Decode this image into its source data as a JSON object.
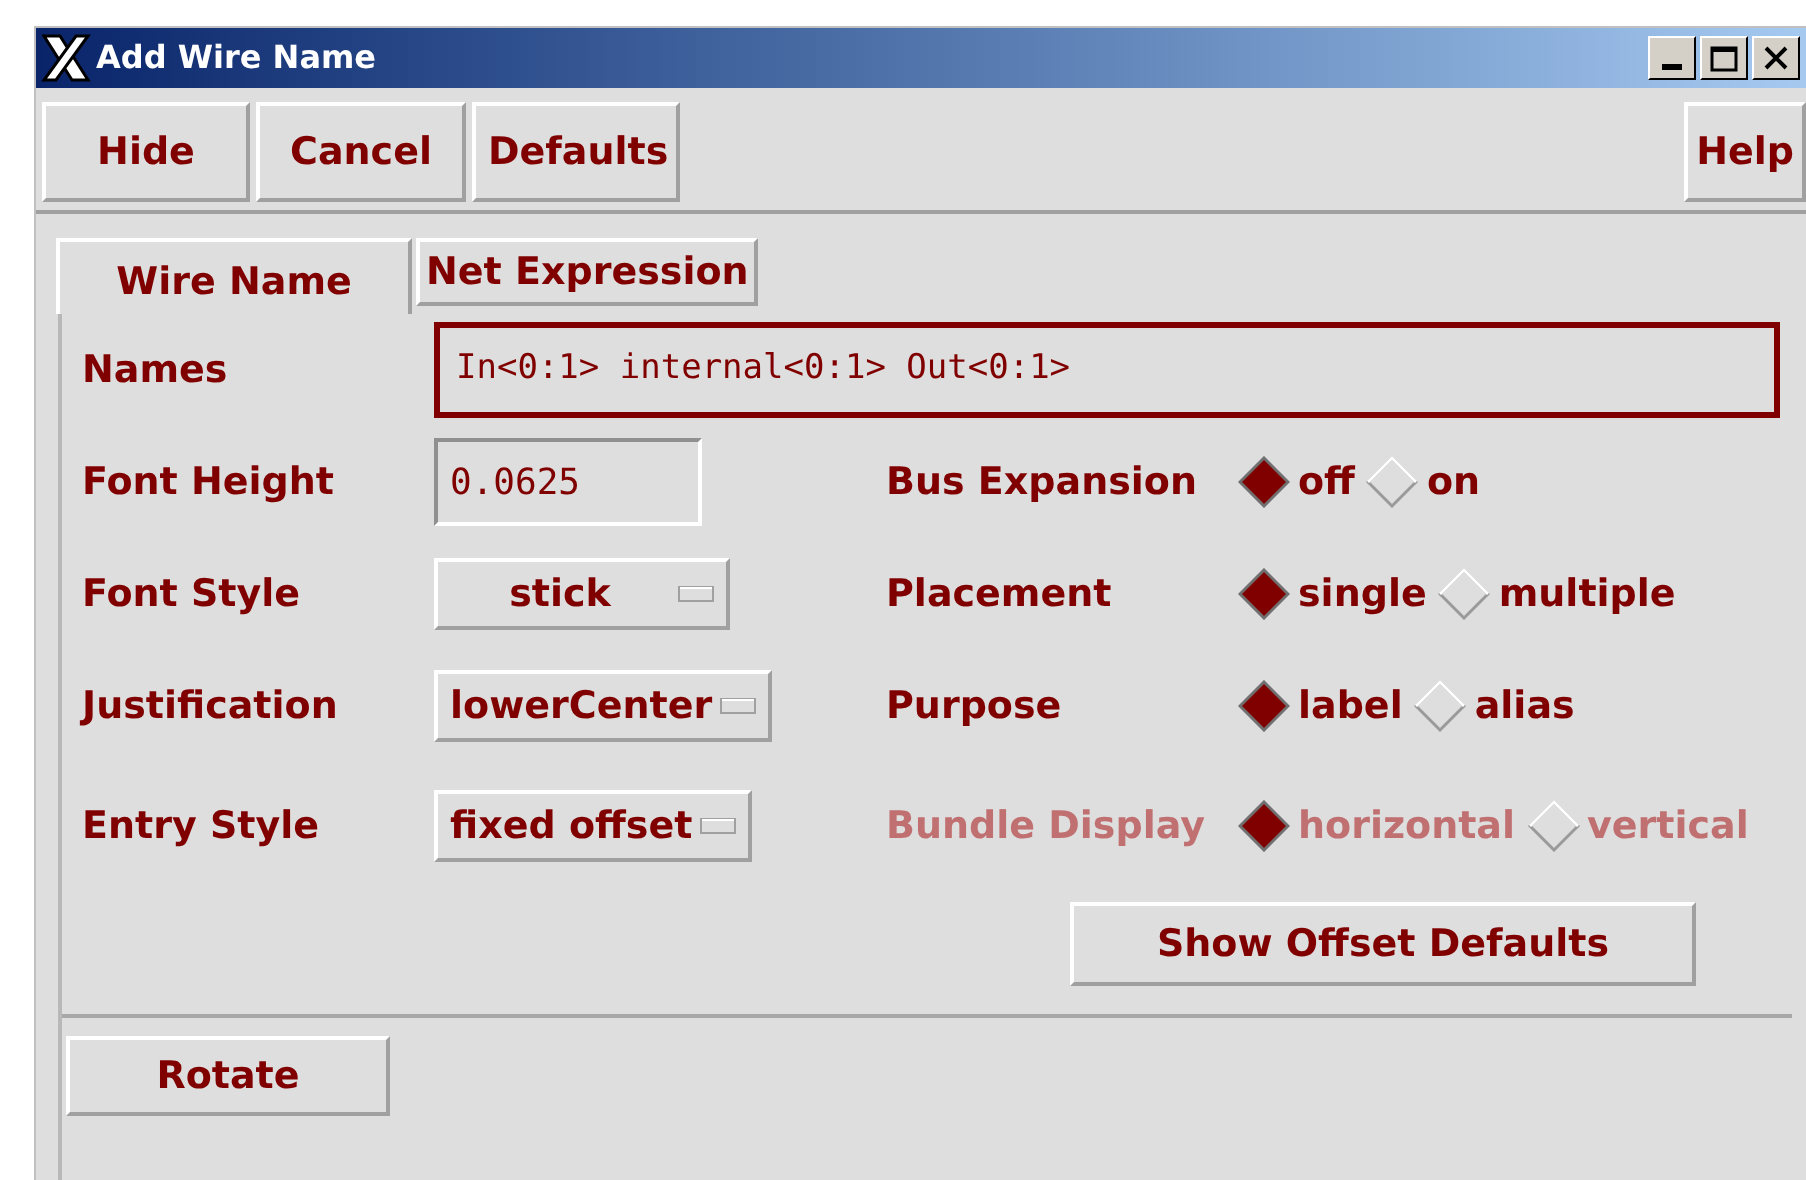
{
  "window": {
    "title": "Add Wire Name"
  },
  "toolbar": [
    {
      "label": "Hide"
    },
    {
      "label": "Cancel"
    },
    {
      "label": "Defaults"
    }
  ],
  "help_button": "Help",
  "tabs": [
    {
      "label": "Wire Name",
      "selected": true
    },
    {
      "label": "Net Expression",
      "selected": false
    }
  ],
  "names": {
    "label": "Names",
    "value": "In<0:1> internal<0:1> Out<0:1>"
  },
  "left_fields": [
    {
      "kind": "text",
      "label": "Font Height",
      "value": "0.0625"
    },
    {
      "kind": "menu",
      "label": "Font Style",
      "value": "stick"
    },
    {
      "kind": "menu",
      "label": "Justification",
      "value": "lowerCenter"
    },
    {
      "kind": "menu",
      "label": "Entry Style",
      "value": "fixed offset"
    }
  ],
  "radio_groups": [
    {
      "label": "Bus Expansion",
      "disabled": false,
      "options": [
        {
          "label": "off",
          "selected": true
        },
        {
          "label": "on",
          "selected": false
        }
      ]
    },
    {
      "label": "Placement",
      "disabled": false,
      "options": [
        {
          "label": "single",
          "selected": true
        },
        {
          "label": "multiple",
          "selected": false
        }
      ]
    },
    {
      "label": "Purpose",
      "disabled": false,
      "options": [
        {
          "label": "label",
          "selected": true
        },
        {
          "label": "alias",
          "selected": false
        }
      ]
    },
    {
      "label": "Bundle Display",
      "disabled": true,
      "options": [
        {
          "label": "horizontal",
          "selected": true
        },
        {
          "label": "vertical",
          "selected": false
        }
      ]
    }
  ],
  "show_offset_button": "Show Offset Defaults",
  "rotate_button": "Rotate"
}
